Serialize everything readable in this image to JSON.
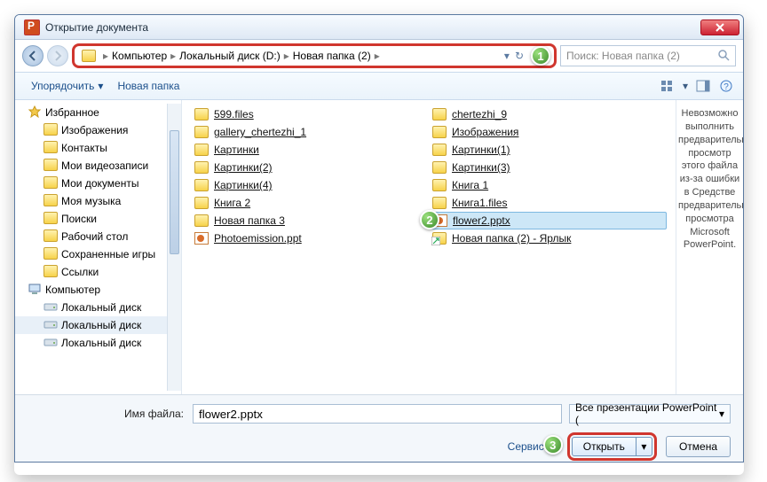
{
  "window": {
    "title": "Открытие документа"
  },
  "nav": {
    "crumbs": [
      "Компьютер",
      "Локальный диск (D:)",
      "Новая папка (2)"
    ],
    "search_placeholder": "Поиск: Новая папка (2)"
  },
  "toolbar": {
    "organize": "Упорядочить",
    "new_folder": "Новая папка"
  },
  "tree": {
    "items": [
      {
        "label": "Избранное",
        "icon": "star"
      },
      {
        "label": "Изображения",
        "icon": "folder",
        "deep": true
      },
      {
        "label": "Контакты",
        "icon": "folder",
        "deep": true
      },
      {
        "label": "Мои видеозаписи",
        "icon": "folder",
        "deep": true
      },
      {
        "label": "Мои документы",
        "icon": "folder",
        "deep": true
      },
      {
        "label": "Моя музыка",
        "icon": "folder",
        "deep": true
      },
      {
        "label": "Поиски",
        "icon": "folder",
        "deep": true
      },
      {
        "label": "Рабочий стол",
        "icon": "folder",
        "deep": true
      },
      {
        "label": "Сохраненные игры",
        "icon": "folder",
        "deep": true
      },
      {
        "label": "Ссылки",
        "icon": "folder",
        "deep": true
      },
      {
        "label": "Компьютер",
        "icon": "computer"
      },
      {
        "label": "Локальный диск",
        "icon": "drive",
        "deep": true
      },
      {
        "label": "Локальный диск",
        "icon": "drive",
        "deep": true,
        "hl": true
      },
      {
        "label": "Локальный диск",
        "icon": "drive",
        "deep": true
      }
    ]
  },
  "files": {
    "col1": [
      {
        "name": "599.files",
        "type": "folder"
      },
      {
        "name": "gallery_chertezhi_1",
        "type": "folder"
      },
      {
        "name": "Картинки",
        "type": "folder"
      },
      {
        "name": "Картинки(2)",
        "type": "folder"
      },
      {
        "name": "Картинки(4)",
        "type": "folder"
      },
      {
        "name": "Книга 2",
        "type": "folder"
      },
      {
        "name": "Новая папка 3",
        "type": "folder"
      },
      {
        "name": "Photoemission.ppt",
        "type": "ppt"
      }
    ],
    "col2": [
      {
        "name": "chertezhi_9",
        "type": "folder"
      },
      {
        "name": "Изображения",
        "type": "folder"
      },
      {
        "name": "Картинки(1)",
        "type": "folder"
      },
      {
        "name": "Картинки(3)",
        "type": "folder"
      },
      {
        "name": "Книга 1",
        "type": "folder"
      },
      {
        "name": "Книга1.files",
        "type": "folder"
      },
      {
        "name": "flower2.pptx",
        "type": "ppt",
        "selected": true
      },
      {
        "name": "Новая папка (2) - Ярлык",
        "type": "shortcut"
      }
    ]
  },
  "preview": {
    "text": "Невозможно выполнить предварительный просмотр этого файла из-за ошибки в Средстве предварительного просмотра Microsoft PowerPoint."
  },
  "bottom": {
    "filename_label": "Имя файла:",
    "filename_value": "flower2.pptx",
    "filter_label": "Все презентации PowerPoint (",
    "service": "Сервис",
    "open": "Открыть",
    "cancel": "Отмена"
  },
  "callouts": {
    "c1": "1",
    "c2": "2",
    "c3": "3"
  }
}
